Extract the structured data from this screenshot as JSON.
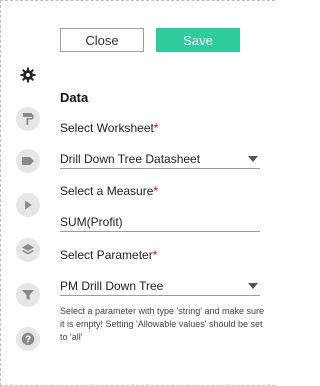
{
  "toolbar": {
    "close_label": "Close",
    "save_label": "Save"
  },
  "icons": [
    "gear-icon",
    "paint-roller-icon",
    "tag-icon",
    "play-icon",
    "layers-icon",
    "filter-icon",
    "help-icon"
  ],
  "panel": {
    "heading": "Data",
    "worksheet": {
      "label": "Select Worksheet",
      "required": "*",
      "value": "Drill Down Tree Datasheet"
    },
    "measure": {
      "label": "Select a Measure",
      "required": "*",
      "value": "SUM(Profit)"
    },
    "parameter": {
      "label": "Select Parameter",
      "required": "*",
      "value": "PM Drill Down Tree"
    },
    "help_text": "Select a parameter with type 'string' and make sure it is empty! Setting 'Allowable values' should be set to 'all'"
  },
  "colors": {
    "accent": "#2ecc9a",
    "required": "#d0021b",
    "icon_bg": "#e6e6e6",
    "icon": "#8a8a8a"
  }
}
